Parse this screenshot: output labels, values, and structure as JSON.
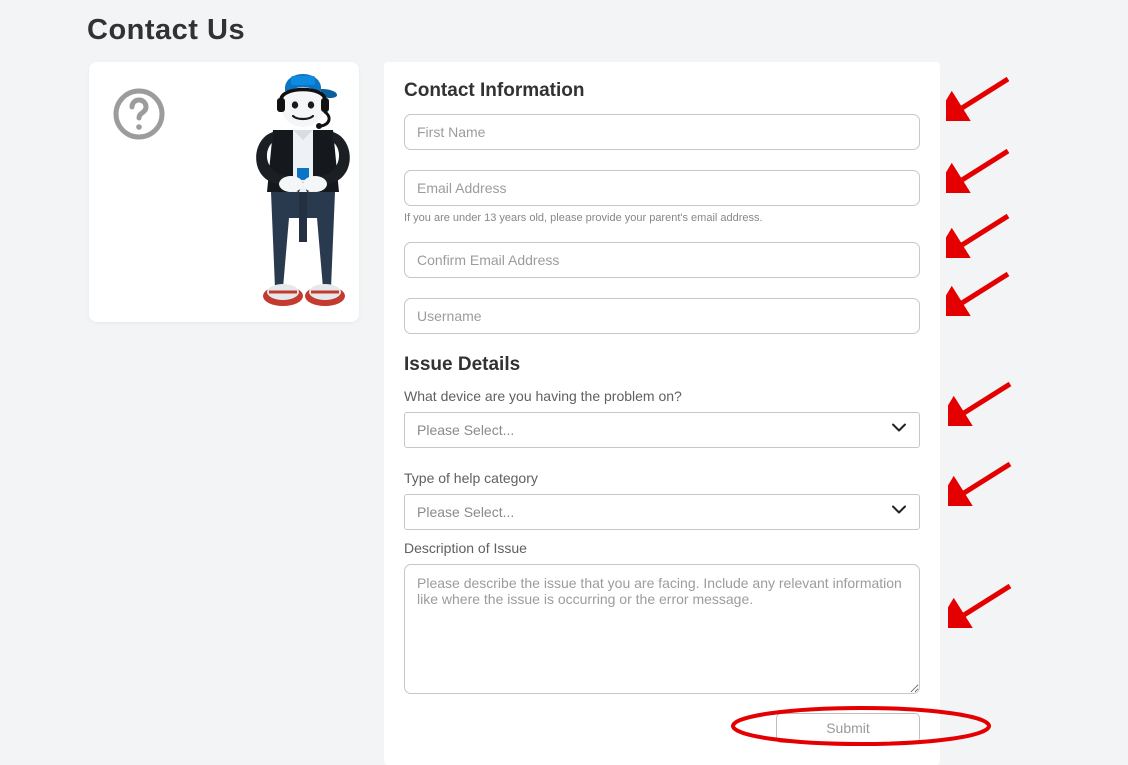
{
  "page": {
    "title": "Contact Us"
  },
  "sections": {
    "contact_info_heading": "Contact Information",
    "issue_details_heading": "Issue Details"
  },
  "fields": {
    "first_name": {
      "placeholder": "First Name",
      "value": ""
    },
    "email": {
      "placeholder": "Email Address",
      "value": "",
      "hint": "If you are under 13 years old, please provide your parent's email address."
    },
    "confirm_email": {
      "placeholder": "Confirm Email Address",
      "value": ""
    },
    "username": {
      "placeholder": "Username",
      "value": ""
    }
  },
  "issue": {
    "device_label": "What device are you having the problem on?",
    "device_selected": "Please Select...",
    "help_category_label": "Type of help category",
    "help_category_selected": "Please Select...",
    "description_label": "Description of Issue",
    "description_placeholder": "Please describe the issue that you are facing. Include any relevant information like where the issue is occurring or the error message.",
    "description_value": ""
  },
  "buttons": {
    "submit": "Submit"
  },
  "icons": {
    "question": "question-mark-icon",
    "chevron": "chevron-down-icon"
  }
}
